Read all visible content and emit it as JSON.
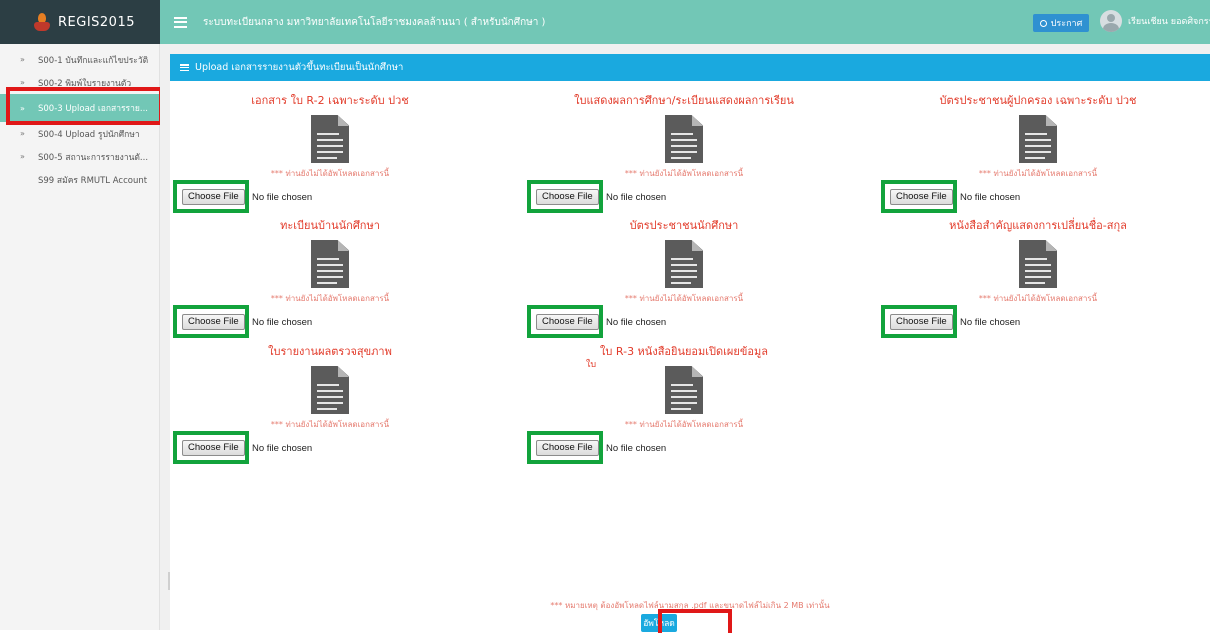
{
  "header": {
    "brand": "REGIS2015",
    "system_title": "ระบบทะเบียนกลาง มหาวิทยาลัยเทคโนโลยีราชมงคลล้านนา ( สำหรับนักศึกษา )",
    "announce_label": "ประกาศ",
    "user_name": "เรียนเชียน ยอดศิจกรรม"
  },
  "sidebar": {
    "items": [
      {
        "label": "S00-1 บันทึกและแก้ไขประวัติ"
      },
      {
        "label": "S00-2 พิมพ์ใบรายงานตัว"
      },
      {
        "label": "S00-3 Upload เอกสารราย..."
      },
      {
        "label": "S00-4 Upload รูปนักศึกษา"
      },
      {
        "label": "S00-5 สถานะการรายงานตั..."
      },
      {
        "label": "S99 สมัคร RMUTL Account"
      }
    ]
  },
  "panel": {
    "title": "Upload เอกสารรายงานตัวขึ้นทะเบียนเป็นนักศึกษา",
    "docs": [
      {
        "title": "เอกสาร ใบ R-2 เฉพาะระดับ ปวช",
        "status": "*** ท่านยังไม่ได้อัพโหลดเอกสารนี้",
        "button": "Choose File",
        "file_text": "No file chosen"
      },
      {
        "title": "ใบแสดงผลการศึกษา/ระเบียนแสดงผลการเรียน",
        "status": "*** ท่านยังไม่ได้อัพโหลดเอกสารนี้",
        "button": "Choose File",
        "file_text": "No file chosen"
      },
      {
        "title": "บัตรประชาชนผู้ปกครอง เฉพาะระดับ ปวช",
        "status": "*** ท่านยังไม่ได้อัพโหลดเอกสารนี้",
        "button": "Choose File",
        "file_text": "No file chosen"
      },
      {
        "title": "ทะเบียนบ้านนักศึกษา",
        "status": "*** ท่านยังไม่ได้อัพโหลดเอกสารนี้",
        "button": "Choose File",
        "file_text": "No file chosen"
      },
      {
        "title": "บัตรประชาชนนักศึกษา",
        "status": "*** ท่านยังไม่ได้อัพโหลดเอกสารนี้",
        "button": "Choose File",
        "file_text": "No file chosen"
      },
      {
        "title": "หนังสือสำคัญแสดงการเปลี่ยนชื่อ-สกุล",
        "status": "*** ท่านยังไม่ได้อัพโหลดเอกสารนี้",
        "button": "Choose File",
        "file_text": "No file chosen"
      },
      {
        "title": "ใบรายงานผลตรวจสุขภาพ",
        "status": "*** ท่านยังไม่ได้อัพโหลดเอกสารนี้",
        "button": "Choose File",
        "file_text": "No file chosen"
      },
      {
        "title": "ใบ R-3 หนังสือยินยอมเปิดเผยข้อมูล",
        "status": "*** ท่านยังไม่ได้อัพโหลดเอกสารนี้",
        "button": "Choose File",
        "file_text": "No file chosen"
      }
    ],
    "stray_text": "ใบ",
    "note": "*** หมายเหตุ ต้องอัพโหลดไฟล์นามสกุล .pdf และขนาดไฟล์ไม่เกิน 2 MB เท่านั้น",
    "submit_label": "อัพโหลด"
  },
  "colors": {
    "accent": "#72c7b6",
    "brand_bg": "#2c3e44",
    "panel_head": "#1aa9df",
    "title_red": "#e23b2a",
    "highlight_red": "#e01818",
    "highlight_green": "#12a33c"
  }
}
